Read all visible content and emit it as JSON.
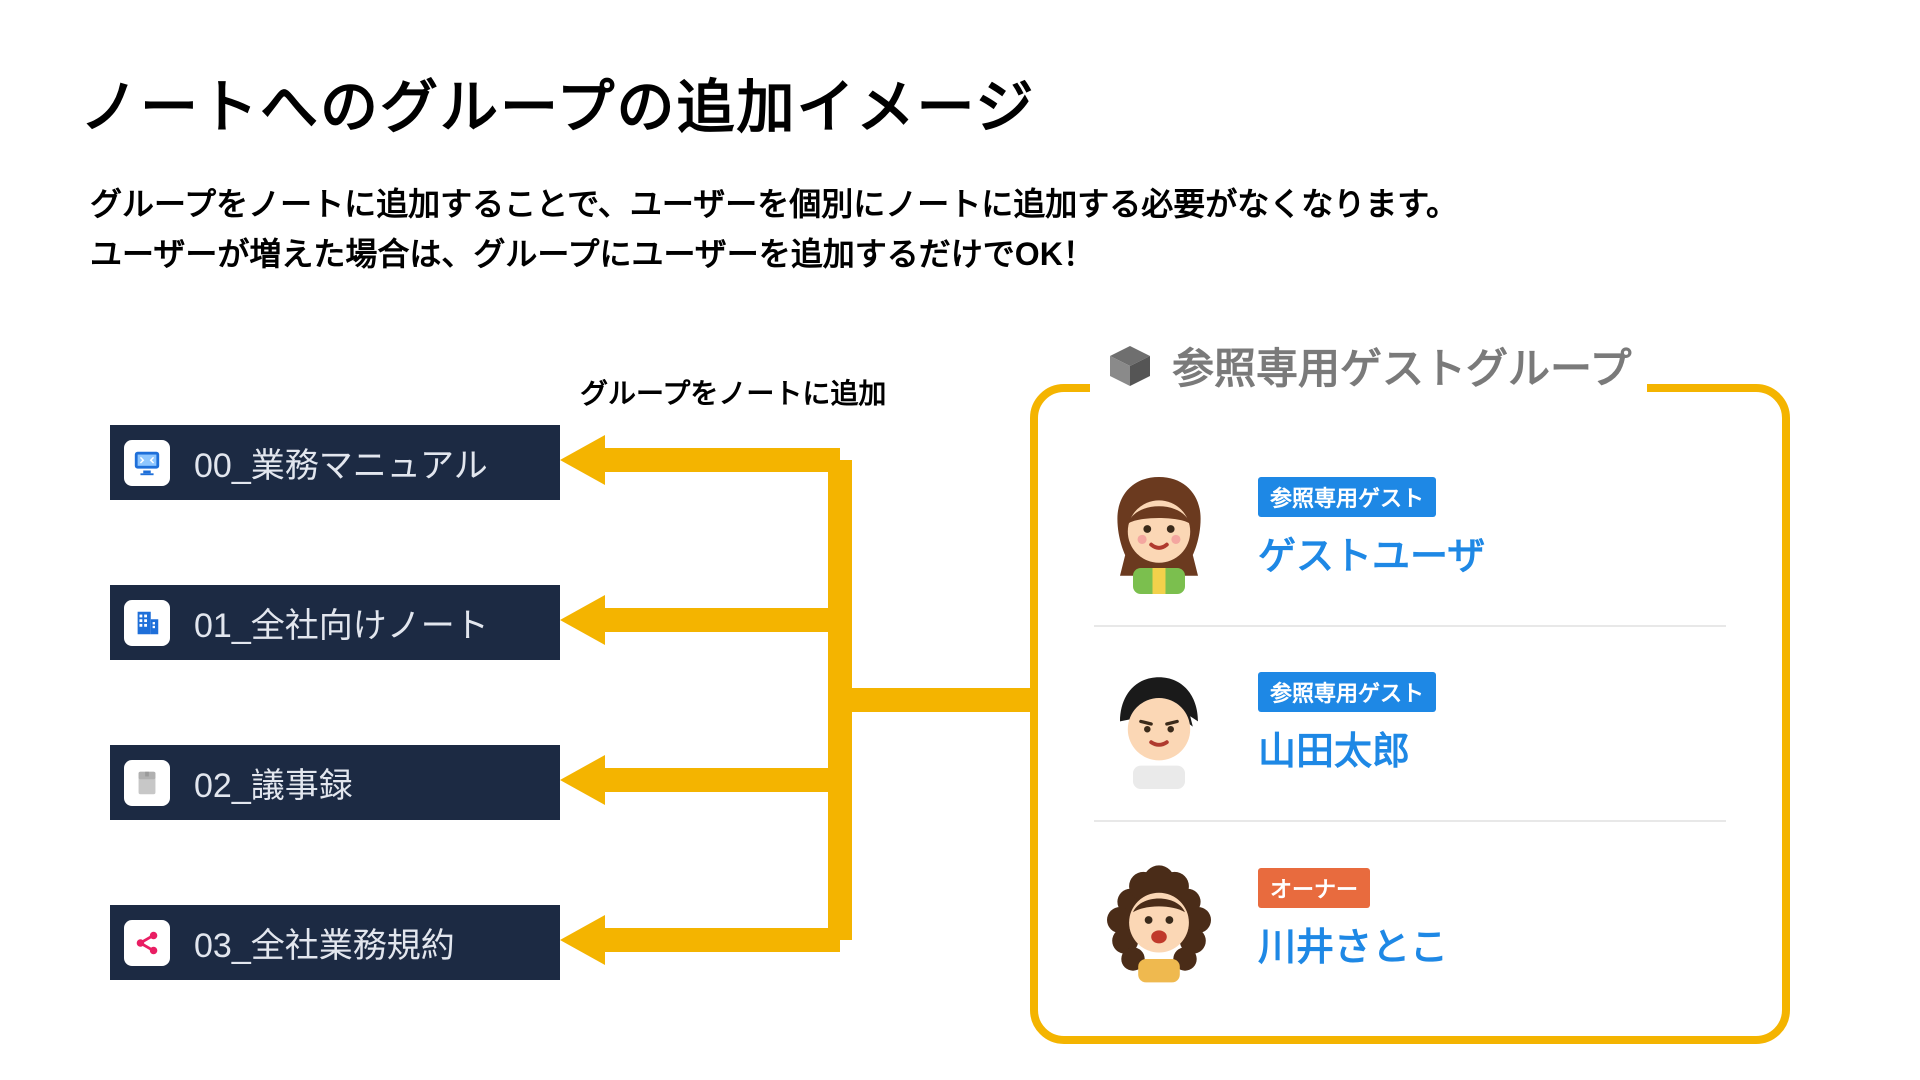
{
  "title": "ノートへのグループの追加イメージ",
  "description_line1": "グループをノートに追加することで、ユーザーを個別にノートに追加する必要がなくなります。",
  "description_line2": "ユーザーが増えた場合は、グループにユーザーを追加するだけでOK！",
  "arrow_caption": "グループをノートに追加",
  "notes": [
    {
      "label": "00_業務マニュアル",
      "icon": "monitor"
    },
    {
      "label": "01_全社向けノート",
      "icon": "building"
    },
    {
      "label": "02_議事録",
      "icon": "document"
    },
    {
      "label": "03_全社業務規約",
      "icon": "share"
    }
  ],
  "group": {
    "title": "参照専用ゲストグループ",
    "members": [
      {
        "badge": "参照専用ゲスト",
        "badge_color": "blue",
        "name": "ゲストユーザ",
        "avatar": "girl-brown"
      },
      {
        "badge": "参照専用ゲスト",
        "badge_color": "blue",
        "name": "山田太郎",
        "avatar": "boy-black"
      },
      {
        "badge": "オーナー",
        "badge_color": "orange",
        "name": "川井さとこ",
        "avatar": "woman-curly"
      }
    ]
  },
  "colors": {
    "note_bg": "#1c2a43",
    "arrow": "#f4b400",
    "link": "#1e88e5",
    "badge_blue": "#1e88e5",
    "badge_orange": "#e86b3e"
  }
}
